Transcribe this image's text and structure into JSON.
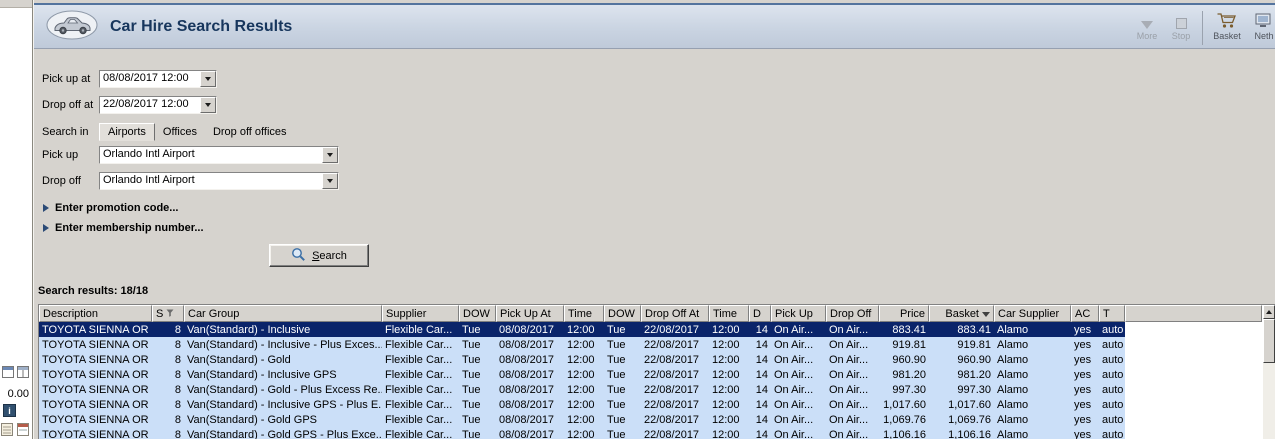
{
  "window": {
    "title": "Car Hire Search Results"
  },
  "toolbar": {
    "items": [
      {
        "label": "More",
        "icon": "more-icon",
        "disabled": true
      },
      {
        "label": "Stop",
        "icon": "stop-icon",
        "disabled": true
      },
      {
        "label": "Basket",
        "icon": "basket-icon",
        "disabled": false
      },
      {
        "label": "Neth",
        "icon": "network-icon",
        "disabled": false
      }
    ]
  },
  "form": {
    "pickup_at": {
      "label": "Pick up at",
      "value": "08/08/2017 12:00"
    },
    "dropoff_at": {
      "label": "Drop off at",
      "value": "22/08/2017 12:00"
    },
    "search_in": {
      "label": "Search in",
      "tabs": [
        {
          "label": "Airports",
          "selected": true
        },
        {
          "label": "Offices",
          "selected": false
        },
        {
          "label": "Drop off offices",
          "selected": false
        }
      ]
    },
    "pickup": {
      "label": "Pick up",
      "value": "Orlando Intl Airport"
    },
    "dropoff": {
      "label": "Drop off",
      "value": "Orlando Intl Airport"
    },
    "promotion_toggle": "Enter promotion code...",
    "membership_toggle": "Enter membership number...",
    "search_button": {
      "underlined": "S",
      "rest": "earch",
      "icon": "magnifier-icon"
    }
  },
  "results": {
    "summary": "Search results: 18/18",
    "columns": [
      "Description",
      "S",
      "Car Group",
      "Supplier",
      "DOW",
      "Pick Up At",
      "Time",
      "DOW",
      "Drop Off At",
      "Time",
      "D",
      "Pick Up",
      "Drop Off",
      "Price",
      "Basket",
      "Car Supplier",
      "AC",
      "T"
    ],
    "rows": [
      {
        "selected": true,
        "cells": [
          "TOYOTA SIENNA OR ...",
          "8",
          "Van(Standard) - Inclusive",
          "Flexible Car...",
          "Tue",
          "08/08/2017",
          "12:00",
          "Tue",
          "22/08/2017",
          "12:00",
          "14",
          "On Air...",
          "On Air...",
          "883.41",
          "883.41",
          "Alamo",
          "yes",
          "auto"
        ]
      },
      {
        "selected": false,
        "cells": [
          "TOYOTA SIENNA OR ...",
          "8",
          "Van(Standard) - Inclusive - Plus Exces...",
          "Flexible Car...",
          "Tue",
          "08/08/2017",
          "12:00",
          "Tue",
          "22/08/2017",
          "12:00",
          "14",
          "On Air...",
          "On Air...",
          "919.81",
          "919.81",
          "Alamo",
          "yes",
          "auto"
        ]
      },
      {
        "selected": false,
        "cells": [
          "TOYOTA SIENNA OR ...",
          "8",
          "Van(Standard) - Gold",
          "Flexible Car...",
          "Tue",
          "08/08/2017",
          "12:00",
          "Tue",
          "22/08/2017",
          "12:00",
          "14",
          "On Air...",
          "On Air...",
          "960.90",
          "960.90",
          "Alamo",
          "yes",
          "auto"
        ]
      },
      {
        "selected": false,
        "cells": [
          "TOYOTA SIENNA OR ...",
          "8",
          "Van(Standard) - Inclusive GPS",
          "Flexible Car...",
          "Tue",
          "08/08/2017",
          "12:00",
          "Tue",
          "22/08/2017",
          "12:00",
          "14",
          "On Air...",
          "On Air...",
          "981.20",
          "981.20",
          "Alamo",
          "yes",
          "auto"
        ]
      },
      {
        "selected": false,
        "cells": [
          "TOYOTA SIENNA OR ...",
          "8",
          "Van(Standard) - Gold - Plus Excess Re...",
          "Flexible Car...",
          "Tue",
          "08/08/2017",
          "12:00",
          "Tue",
          "22/08/2017",
          "12:00",
          "14",
          "On Air...",
          "On Air...",
          "997.30",
          "997.30",
          "Alamo",
          "yes",
          "auto"
        ]
      },
      {
        "selected": false,
        "cells": [
          "TOYOTA SIENNA OR ...",
          "8",
          "Van(Standard) - Inclusive GPS - Plus E...",
          "Flexible Car...",
          "Tue",
          "08/08/2017",
          "12:00",
          "Tue",
          "22/08/2017",
          "12:00",
          "14",
          "On Air...",
          "On Air...",
          "1,017.60",
          "1,017.60",
          "Alamo",
          "yes",
          "auto"
        ]
      },
      {
        "selected": false,
        "cells": [
          "TOYOTA SIENNA OR ...",
          "8",
          "Van(Standard) - Gold GPS",
          "Flexible Car...",
          "Tue",
          "08/08/2017",
          "12:00",
          "Tue",
          "22/08/2017",
          "12:00",
          "14",
          "On Air...",
          "On Air...",
          "1,069.76",
          "1,069.76",
          "Alamo",
          "yes",
          "auto"
        ]
      },
      {
        "selected": false,
        "cells": [
          "TOYOTA SIENNA OR ...",
          "8",
          "Van(Standard) - Gold GPS - Plus Exce...",
          "Flexible Car...",
          "Tue",
          "08/08/2017",
          "12:00",
          "Tue",
          "22/08/2017",
          "12:00",
          "14",
          "On Air...",
          "On Air...",
          "1,106.16",
          "1,106.16",
          "Alamo",
          "yes",
          "auto"
        ]
      }
    ]
  },
  "sidebar": {
    "amount": "0.00"
  },
  "colors": {
    "selection": "#0a246a",
    "row_highlight": "#cbdff8",
    "title_text": "#17365d",
    "chrome": "#d6d3ce"
  }
}
